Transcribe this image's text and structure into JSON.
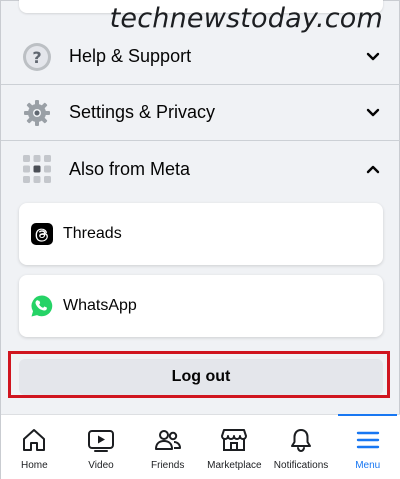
{
  "watermark": "technewstoday.com",
  "menu": {
    "help": {
      "label": "Help & Support",
      "icon": "question-icon"
    },
    "settings": {
      "label": "Settings & Privacy",
      "icon": "gear-icon"
    },
    "meta": {
      "label": "Also from Meta",
      "icon": "grid-icon",
      "expanded": true
    }
  },
  "meta_apps": [
    {
      "label": "Threads",
      "icon": "threads-icon"
    },
    {
      "label": "WhatsApp",
      "icon": "whatsapp-icon",
      "color": "#25d366"
    }
  ],
  "logout": {
    "label": "Log out",
    "highlight_color": "#d0151f"
  },
  "tabbar": {
    "active_color": "#1877f2",
    "tabs": [
      {
        "label": "Home",
        "icon": "home-icon"
      },
      {
        "label": "Video",
        "icon": "video-icon"
      },
      {
        "label": "Friends",
        "icon": "friends-icon"
      },
      {
        "label": "Marketplace",
        "icon": "marketplace-icon"
      },
      {
        "label": "Notifications",
        "icon": "bell-icon"
      },
      {
        "label": "Menu",
        "icon": "menu-icon",
        "active": true
      }
    ]
  }
}
